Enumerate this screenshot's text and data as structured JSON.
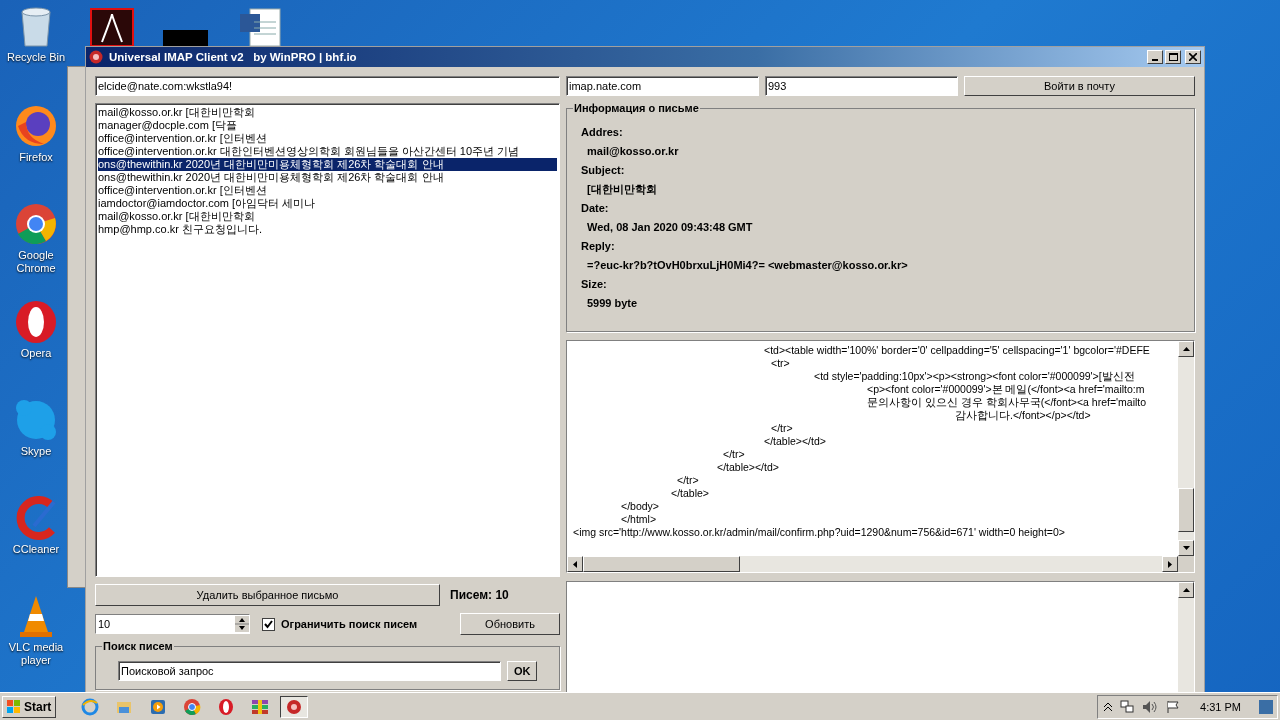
{
  "desktop": {
    "icons": [
      {
        "label": "Recycle Bin",
        "kind": "trash"
      },
      {
        "label": "Firefox",
        "kind": "firefox"
      },
      {
        "label": "Google Chrome",
        "kind": "chrome"
      },
      {
        "label": "Opera",
        "kind": "opera"
      },
      {
        "label": "Skype",
        "kind": "skype"
      },
      {
        "label": "CCleaner",
        "kind": "ccleaner"
      },
      {
        "label": "VLC media player",
        "kind": "vlc"
      }
    ],
    "top_icons": [
      {
        "kind": "pdf"
      },
      {
        "kind": "blank"
      },
      {
        "kind": "doc"
      }
    ]
  },
  "window": {
    "title": "Universal IMAP Client v2   by WinPRO | bhf.io"
  },
  "login": {
    "account": "elcide@nate.com:wkstla94!",
    "server": "imap.nate.com",
    "port": "993",
    "button": "Войти в почту"
  },
  "messages": [
    {
      "text": "mail@kosso.or.kr [대한비만학회",
      "selected": false
    },
    {
      "text": "manager@docple.com [닥플",
      "selected": false
    },
    {
      "text": "office@intervention.or.kr [인터벤션",
      "selected": false
    },
    {
      "text": "office@intervention.or.kr 대한인터벤션영상의학회 회원님들을 아산간센터 10주년 기념",
      "selected": false
    },
    {
      "text": "ons@thewithin.kr 2020년 대한비만미용체형학회 제26차 학술대회 안내",
      "selected": true
    },
    {
      "text": "ons@thewithin.kr 2020년 대한비만미용체형학회 제26차 학술대회 안내",
      "selected": false
    },
    {
      "text": "office@intervention.or.kr [인터벤션",
      "selected": false
    },
    {
      "text": "iamdoctor@iamdoctor.com [아임닥터 세미나",
      "selected": false
    },
    {
      "text": "mail@kosso.or.kr [대한비만학회",
      "selected": false
    },
    {
      "text": "hmp@hmp.co.kr 친구요청입니다.",
      "selected": false
    }
  ],
  "delete_button": "Удалить выбранное письмо",
  "count": "Писем: 10",
  "limit": {
    "value": "10",
    "checked": true,
    "label": "Ограничить поиск писем"
  },
  "refresh_button": "Обновить",
  "search": {
    "title": "Поиск писем",
    "value": "Поисковой запрос",
    "button": "OK"
  },
  "info": {
    "title": "Информация о письме",
    "fields": [
      {
        "label": "Addres:",
        "value": "mail@kosso.or.kr"
      },
      {
        "label": "Subject:",
        "value": "[대한비만학회"
      },
      {
        "label": "Date:",
        "value": "Wed, 08 Jan 2020 09:43:48 GMT"
      },
      {
        "label": "Reply:",
        "value": "=?euc-kr?b?tOvH0brxuLjH0Mi4?= <webmaster@kosso.or.kr>"
      },
      {
        "label": "Size:",
        "value": "5999 byte"
      }
    ]
  },
  "source_lines": [
    "<td><table width='100%' border='0' cellpadding='5' cellspacing='1' bgcolor='#DEFE",
    "<tr>",
    "<td style='padding:10px'><p><strong><font color='#000099'>[발신전",
    "<p><font color='#000099'>본 메일(</font><a href='mailto:m",
    "문의사항이 있으신 경우 학회사무국(</font><a href='mailto",
    "감사합니다.</font></p></td>",
    "</tr>",
    "</table></td>",
    "</tr>",
    "</table></td>",
    "</tr>",
    "</table>",
    "</body>",
    "</html>",
    "<img src='http://www.kosso.or.kr/admin/mail/confirm.php?uid=1290&num=756&id=671' width=0 height=0>"
  ],
  "taskbar": {
    "start": "Start",
    "apps": [
      {
        "kind": "ie",
        "selected": false
      },
      {
        "kind": "folder",
        "selected": false
      },
      {
        "kind": "media",
        "selected": false
      },
      {
        "kind": "chrome",
        "selected": false
      },
      {
        "kind": "opera",
        "selected": false
      },
      {
        "kind": "archive",
        "selected": false
      },
      {
        "kind": "imap",
        "selected": true
      }
    ],
    "clock": "4:31 PM"
  }
}
